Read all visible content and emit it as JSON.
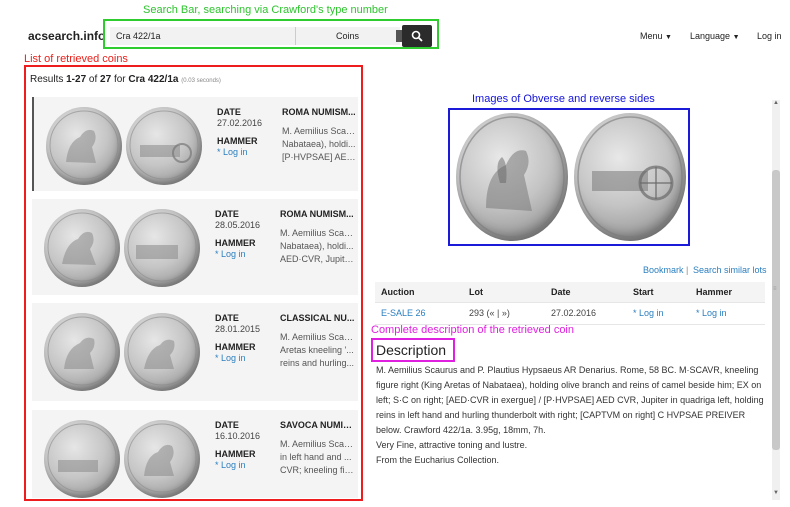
{
  "annotations": {
    "search_bar": "Search Bar, searching via Crawford's type number",
    "list": "List of retrieved coins",
    "images": "Images of Obverse and reverse sides",
    "description": "Complete description of the retrieved coin"
  },
  "navbar": {
    "brand": "acsearch.info",
    "search_value": "Cra 422/1a",
    "category": "Coins",
    "menu": "Menu",
    "language": "Language",
    "login": "Log in"
  },
  "results": {
    "prefix": "Results ",
    "range": "1-27",
    "of": " of ",
    "total": "27",
    "for": " for ",
    "query": "Cra 422/1a",
    "time": "(0.03 seconds)"
  },
  "labels": {
    "date": "DATE",
    "hammer": "HAMMER",
    "login": "* Log in"
  },
  "cards": [
    {
      "date": "27.02.2016",
      "house": "ROMA NUMISM...",
      "lines": [
        "M. Aemilius Scau...",
        "Nabataea), holdi...",
        "[P·HVPSAE] AED..."
      ]
    },
    {
      "date": "28.05.2016",
      "house": "ROMA NUMISM...",
      "lines": [
        "M. Aemilius Scau...",
        "Nabataea), holdi...",
        "AED·CVR, Jupite..."
      ]
    },
    {
      "date": "28.01.2015",
      "house": "CLASSICAL NU...",
      "lines": [
        "M. Aemilius Scau...",
        "Aretas kneeling '...",
        "reins and hurling..."
      ]
    },
    {
      "date": "16.10.2016",
      "house": "SAVOCA NUMIS...",
      "lines": [
        "M. Aemilius Scau...",
        "in left hand and ...",
        "CVR; kneeling fig..."
      ]
    }
  ],
  "links": {
    "bookmark": "Bookmark",
    "sep": "|",
    "similar": "Search similar lots"
  },
  "auction_table": {
    "headers": [
      "Auction",
      "Lot",
      "Date",
      "Start",
      "Hammer"
    ],
    "row": {
      "auction": "E-SALE 26",
      "lot": "293 (« | »)",
      "date": "27.02.2016",
      "start": "* Log in",
      "hammer": "* Log in"
    }
  },
  "description": {
    "title": "Description",
    "paragraphs": [
      "M. Aemilius Scaurus and P. Plautius Hypsaeus AR Denarius. Rome, 58 BC. M·SCAVR, kneeling figure right (King Aretas of Nabataea), holding olive branch and reins of camel beside him; EX on left; S·C on right; [AED·CVR in exergue] / [P·HVPSAE] AED CVR, Jupiter in quadriga left, holding reins in left hand and hurling thunderbolt with right; [CAPTVM on right] C HVPSAE PREIVER below. Crawford 422/1a. 3.95g, 18mm, 7h.",
      "Very Fine, attractive toning and lustre.",
      "From the Eucharius Collection."
    ]
  },
  "colors": {
    "link": "#2a7fc0",
    "annotation_green": "#2ecc2e",
    "annotation_red": "#ee1c1c",
    "annotation_blue": "#1a1ad8",
    "annotation_magenta": "#e020e0"
  }
}
